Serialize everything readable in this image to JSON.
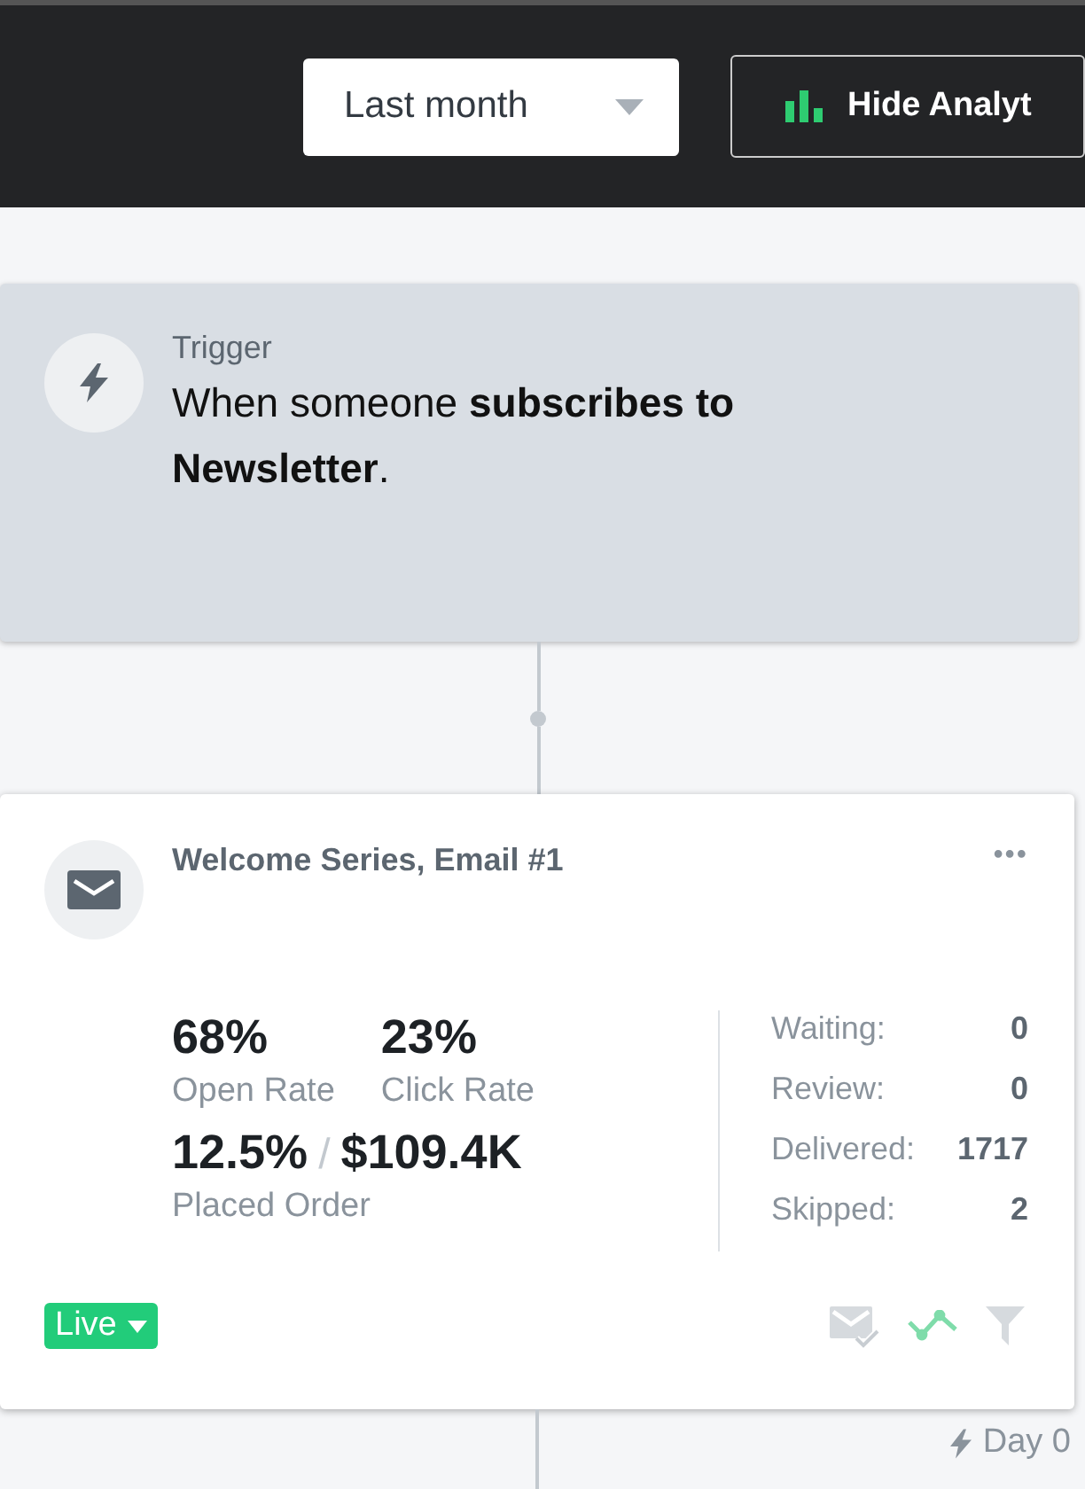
{
  "toolbar": {
    "range": {
      "value": "Last month"
    },
    "analytics_button": {
      "label": "Hide Analyt"
    }
  },
  "trigger": {
    "label": "Trigger",
    "text": "When someone **subscribes to Newsletter**."
  },
  "email": {
    "title": "Welcome Series, Email #1",
    "menu": "•••",
    "stats": [
      {
        "value": "68%",
        "label": "Open Rate"
      },
      {
        "value": "23%",
        "label": "Click Rate"
      }
    ],
    "order": {
      "percent": "12.5%",
      "separator": "/",
      "amount": "$109.4K",
      "label": "Placed Order"
    },
    "counts": [
      {
        "label": "Waiting:",
        "value": "0"
      },
      {
        "label": "Review:",
        "value": "0"
      },
      {
        "label": "Delivered:",
        "value": "1717"
      },
      {
        "label": "Skipped:",
        "value": "2"
      }
    ],
    "status": "Live",
    "actions": [
      {
        "kind": "email-check",
        "active": false
      },
      {
        "kind": "trend",
        "active": true
      },
      {
        "kind": "filter",
        "active": false
      }
    ]
  },
  "delay": "Day 0"
}
